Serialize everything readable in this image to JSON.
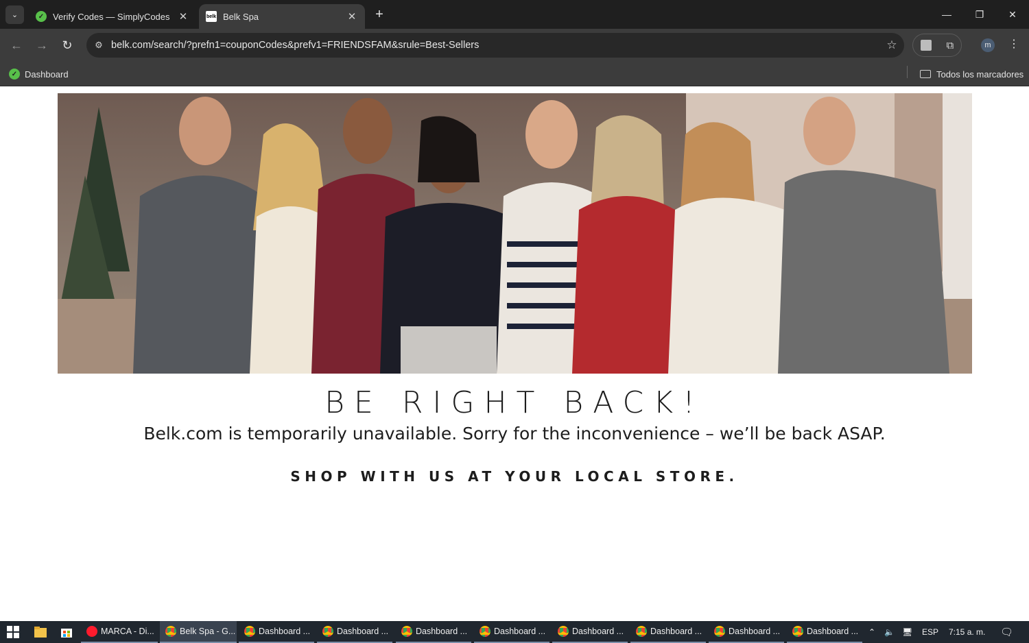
{
  "browser": {
    "tabs": [
      {
        "title": "Verify Codes — SimplyCodes",
        "icon": "simplycodes-icon",
        "active": false
      },
      {
        "title": "Belk Spa",
        "icon": "belk-icon",
        "active": true
      }
    ],
    "belk_fav_text": "belk",
    "url": "belk.com/search/?prefn1=couponCodes&prefv1=FRIENDSFAM&srule=Best-Sellers",
    "profile_initial": "m",
    "bookmarks": {
      "dashboard": "Dashboard",
      "all_bookmarks": "Todos los marcadores"
    }
  },
  "page": {
    "headline": "BE RIGHT BACK!",
    "message": "Belk.com is temporarily unavailable. Sorry for the inconvenience – we’ll be back ASAP.",
    "shop_message": "SHOP WITH US AT YOUR LOCAL STORE."
  },
  "taskbar": {
    "items": [
      {
        "label": "MARCA - Di...",
        "icon": "opera"
      },
      {
        "label": "Belk Spa - G...",
        "icon": "chrome",
        "active": true
      },
      {
        "label": "Dashboard ...",
        "icon": "chrome"
      },
      {
        "label": "Dashboard ...",
        "icon": "chrome"
      },
      {
        "label": "Dashboard ...",
        "icon": "chrome"
      },
      {
        "label": "Dashboard ...",
        "icon": "chrome"
      },
      {
        "label": "Dashboard ...",
        "icon": "chrome"
      },
      {
        "label": "Dashboard ...",
        "icon": "chrome"
      },
      {
        "label": "Dashboard ...",
        "icon": "chrome"
      },
      {
        "label": "Dashboard ...",
        "icon": "chrome"
      }
    ],
    "language": "ESP",
    "time": "7:15 a. m."
  },
  "colors": {
    "chrome_dark": "#1f1f1f",
    "chrome_toolbar": "#3c3c3c",
    "taskbar": "#20272f",
    "text": "#1d1d1d"
  }
}
